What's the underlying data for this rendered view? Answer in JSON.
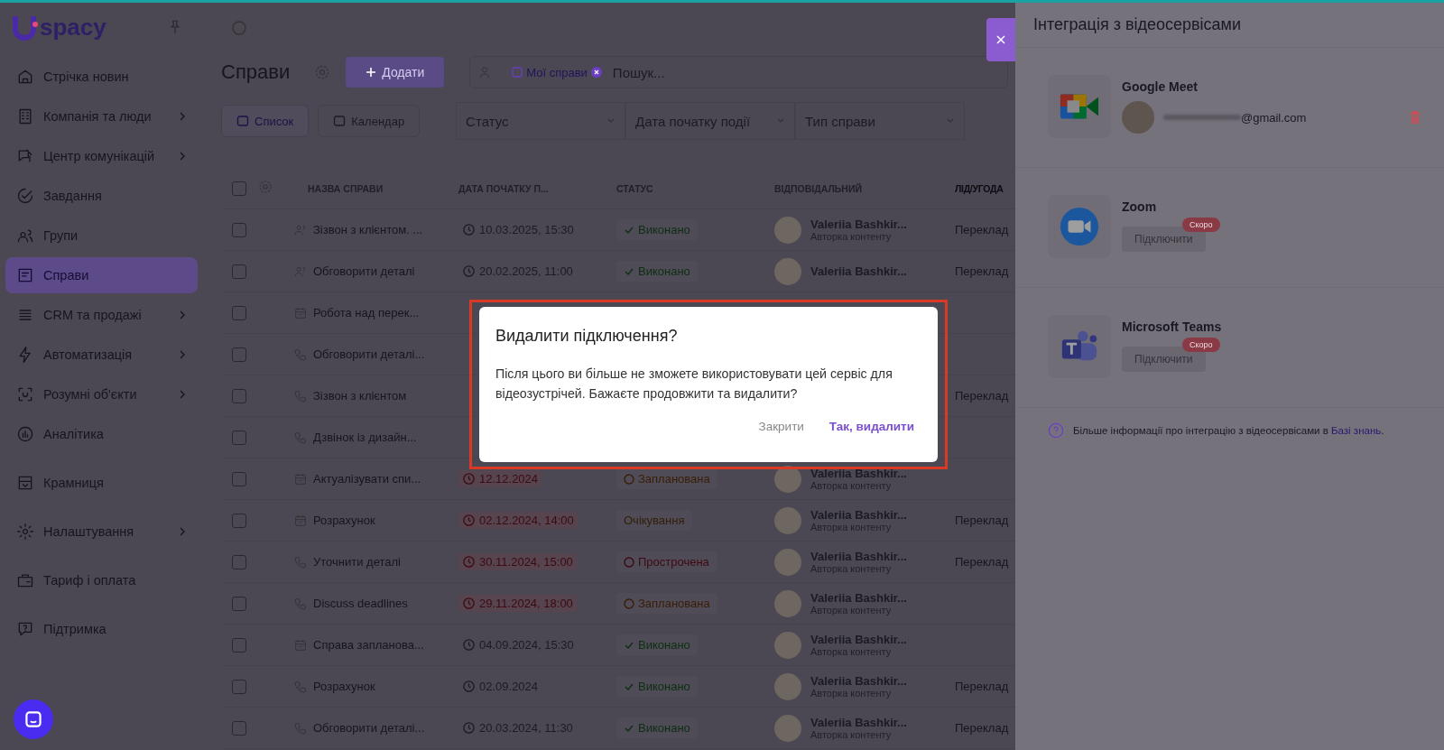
{
  "sidebar": {
    "logo": "spacy",
    "groups": [
      [
        {
          "label": "Стрічка новин",
          "expandable": false,
          "selected": false
        },
        {
          "label": "Компанія та люди",
          "expandable": true,
          "selected": false
        },
        {
          "label": "Центр комунікацій",
          "expandable": true,
          "selected": false
        },
        {
          "label": "Завдання",
          "expandable": false,
          "selected": false
        },
        {
          "label": "Групи",
          "expandable": false,
          "selected": false
        },
        {
          "label": "Справи",
          "expandable": false,
          "selected": true
        },
        {
          "label": "CRM та продажі",
          "expandable": true,
          "selected": false
        },
        {
          "label": "Автоматизація",
          "expandable": true,
          "selected": false
        },
        {
          "label": "Розумні об'єкти",
          "expandable": true,
          "selected": false
        },
        {
          "label": "Аналітика",
          "expandable": false,
          "selected": false
        }
      ],
      [
        {
          "label": "Крамниця",
          "expandable": false,
          "selected": false
        }
      ],
      [
        {
          "label": "Налаштування",
          "expandable": true,
          "selected": false
        }
      ],
      [
        {
          "label": "Тариф і оплата",
          "expandable": false,
          "selected": false
        }
      ],
      [
        {
          "label": "Підтримка",
          "expandable": false,
          "selected": false
        }
      ]
    ]
  },
  "page": {
    "title": "Справи",
    "add_button": "Додати",
    "filter_chip": "Мої справи",
    "search": {
      "placeholder": "Пошук..."
    },
    "views": [
      {
        "label": "Список",
        "selected": true
      },
      {
        "label": "Календар",
        "selected": false
      }
    ],
    "filters": [
      "Статус",
      "Дата початку події",
      "Тип справи"
    ]
  },
  "table": {
    "all_checked": false,
    "columns": [
      "НАЗВА СПРАВИ",
      "ДАТА ПОЧАТКУ П...",
      "СТАТУС",
      "ВІДПОВІДАЛЬНИЙ",
      "ЛІД/УГОДА"
    ],
    "rows": [
      {
        "kind": "meeting",
        "checked": false,
        "name": "Зізвон з клієнтом. ...",
        "date": "10.03.2025, 15:30",
        "overdue": false,
        "status": {
          "label": "Виконано",
          "kind": "done"
        },
        "owner": {
          "name": "Valeriia Bashkir...",
          "role": "Авторка контенту"
        },
        "lead": "Переклад"
      },
      {
        "kind": "meeting",
        "checked": false,
        "name": "Обговорити деталі",
        "date": "20.02.2025, 11:00",
        "overdue": false,
        "status": {
          "label": "Виконано",
          "kind": "done"
        },
        "owner": {
          "name": "Valeriia Bashkir..."
        },
        "lead": "Переклад"
      },
      {
        "kind": "task",
        "checked": false,
        "name": "Робота над перек..."
      },
      {
        "kind": "call",
        "checked": false,
        "name": "Обговорити деталі..."
      },
      {
        "kind": "call",
        "checked": false,
        "name": "Зізвон з клієнтом",
        "lead": "Переклад"
      },
      {
        "kind": "call",
        "checked": false,
        "name": "Дзвінок із дизайн..."
      },
      {
        "kind": "task",
        "checked": false,
        "name": "Актуалізувати спи...",
        "date": "12.12.2024",
        "overdue": true,
        "status": {
          "label": "Запланована",
          "kind": "planned"
        },
        "owner": {
          "name": "Valeriia Bashkir...",
          "role": "Авторка контенту"
        }
      },
      {
        "kind": "task",
        "checked": false,
        "name": "Розрахунок",
        "date": "02.12.2024, 14:00",
        "overdue": true,
        "status": {
          "label": "Очікування",
          "kind": "waiting"
        },
        "owner": {
          "name": "Valeriia Bashkir...",
          "role": "Авторка контенту"
        },
        "lead": "Переклад"
      },
      {
        "kind": "call",
        "checked": false,
        "name": "Уточнити деталі",
        "date": "30.11.2024, 15:00",
        "overdue": true,
        "status": {
          "label": "Прострочена",
          "kind": "overdue"
        },
        "owner": {
          "name": "Valeriia Bashkir...",
          "role": "Авторка контенту"
        },
        "lead": "Переклад"
      },
      {
        "kind": "call",
        "checked": false,
        "name": "Discuss deadlines",
        "date": "29.11.2024, 18:00",
        "overdue": true,
        "status": {
          "label": "Запланована",
          "kind": "planned"
        },
        "owner": {
          "name": "Valeriia Bashkir...",
          "role": "Авторка контенту"
        }
      },
      {
        "kind": "task",
        "checked": false,
        "name": "Справа запланова...",
        "date": "04.09.2024, 15:30",
        "overdue": false,
        "status": {
          "label": "Виконано",
          "kind": "done"
        },
        "owner": {
          "name": "Valeriia Bashkir...",
          "role": "Авторка контенту"
        }
      },
      {
        "kind": "call",
        "checked": false,
        "name": "Розрахунок",
        "date": "02.09.2024",
        "overdue": false,
        "status": {
          "label": "Виконано",
          "kind": "done"
        },
        "owner": {
          "name": "Valeriia Bashkir...",
          "role": "Авторка контенту"
        },
        "lead": "Переклад"
      },
      {
        "kind": "call",
        "checked": false,
        "name": "Обговорити деталі...",
        "date": "20.03.2024, 11:30",
        "overdue": false,
        "status": {
          "label": "Виконано",
          "kind": "done"
        },
        "owner": {
          "name": "Valeriia Bashkir...",
          "role": "Авторка контенту"
        },
        "lead": "Переклад"
      }
    ]
  },
  "panel": {
    "title": "Інтеграція з відеосервісами",
    "services": [
      {
        "kind": "meet",
        "name": "Google Meet",
        "connected": true,
        "account": "@gmail.com"
      },
      {
        "kind": "zoom",
        "name": "Zoom",
        "connected": false,
        "button": "Підключити",
        "badge": "Скоро"
      },
      {
        "kind": "teams",
        "name": "Microsoft Teams",
        "connected": false,
        "button": "Підключити",
        "badge": "Скоро"
      }
    ],
    "footer": {
      "text": "Більше інформації про інтеграцію з відеосервісами в",
      "link": "Базі знань",
      "after": "."
    }
  },
  "dialog": {
    "title": "Видалити підключення?",
    "message": "Після цього ви більше не зможете використовувати цей сервіс для відеозустрічей. Бажаєте продовжити та видалити?",
    "buttons": [
      {
        "label": "Закрити",
        "kind": "secondary"
      },
      {
        "label": "Так, видалити",
        "kind": "primary"
      }
    ]
  }
}
